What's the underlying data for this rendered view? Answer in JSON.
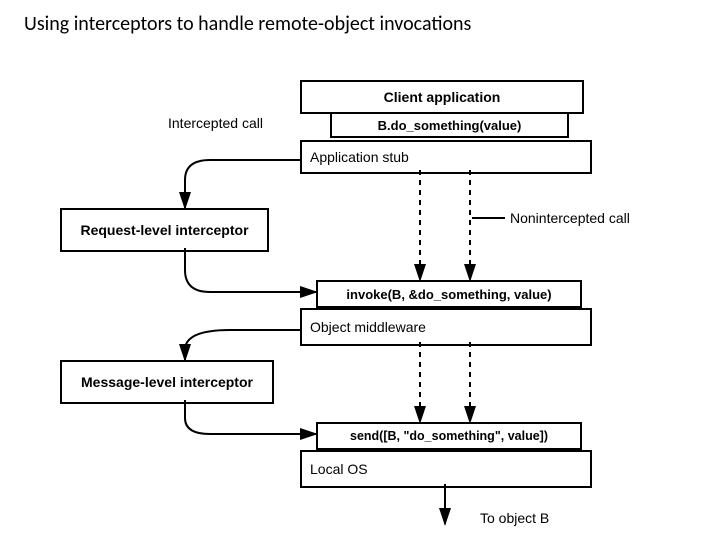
{
  "title": "Using interceptors to handle remote-object invocations",
  "boxes": {
    "client_app": "Client application",
    "call_sig": "B.do_something(value)",
    "app_stub": "Application stub",
    "req_interceptor": "Request-level interceptor",
    "invoke_sig": "invoke(B, &do_something, value)",
    "obj_middleware": "Object middleware",
    "msg_interceptor": "Message-level interceptor",
    "send_sig": "send([B, \"do_something\", value])",
    "local_os": "Local OS"
  },
  "labels": {
    "intercepted": "Intercepted call",
    "nonintercepted": "Nonintercepted call",
    "to_object_b": "To object B"
  }
}
